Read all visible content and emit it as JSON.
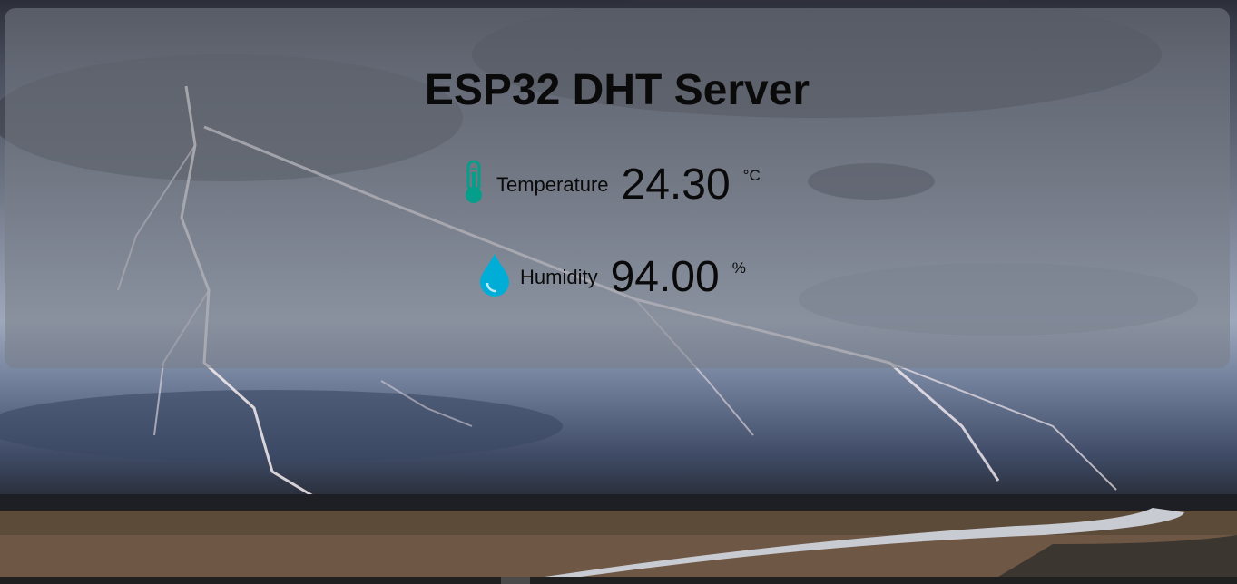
{
  "header": {
    "title": "ESP32 DHT Server"
  },
  "readings": [
    {
      "icon": "thermometer-icon",
      "label": "Temperature",
      "value": "24.30",
      "unit": "°C",
      "icon_color": "#059e8a"
    },
    {
      "icon": "droplet-icon",
      "label": "Humidity",
      "value": "94.00",
      "unit": "%",
      "icon_color": "#00add6"
    }
  ]
}
